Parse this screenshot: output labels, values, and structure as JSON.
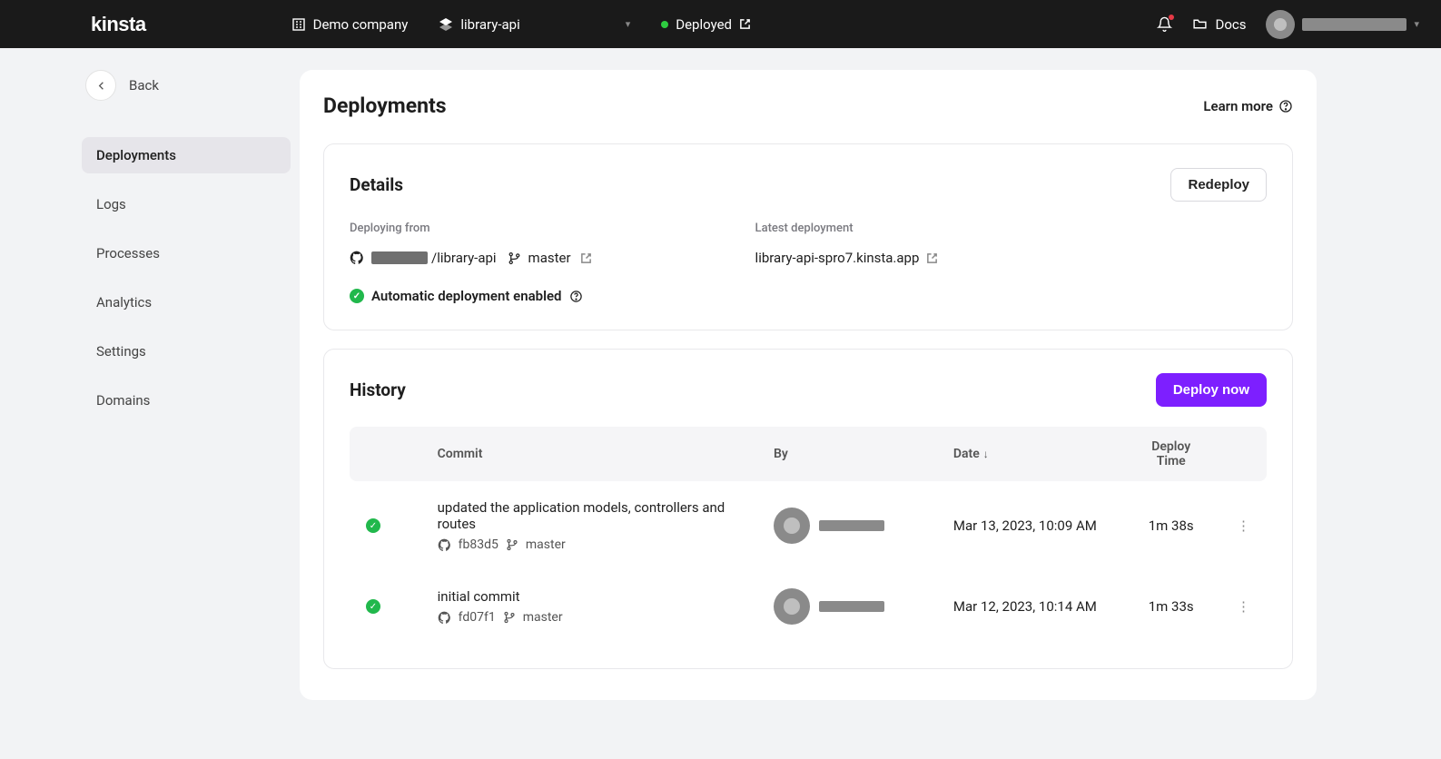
{
  "header": {
    "logo": "kinsta",
    "company": "Demo company",
    "app": "library-api",
    "status": "Deployed",
    "docs": "Docs"
  },
  "sidebar": {
    "back": "Back",
    "items": [
      "Deployments",
      "Logs",
      "Processes",
      "Analytics",
      "Settings",
      "Domains"
    ],
    "active_index": 0
  },
  "page": {
    "title": "Deployments",
    "learn_more": "Learn more"
  },
  "details": {
    "title": "Details",
    "redeploy": "Redeploy",
    "deploying_from_label": "Deploying from",
    "repo_suffix": "/library-api",
    "branch": "master",
    "latest_label": "Latest deployment",
    "latest_url": "library-api-spro7.kinsta.app",
    "auto": "Automatic deployment enabled"
  },
  "history": {
    "title": "History",
    "deploy_now": "Deploy now",
    "columns": {
      "commit": "Commit",
      "by": "By",
      "date": "Date",
      "time": "Deploy Time"
    },
    "rows": [
      {
        "msg": "updated the application models, controllers and routes",
        "hash": "fb83d5",
        "branch": "master",
        "date": "Mar 13, 2023, 10:09 AM",
        "time": "1m 38s"
      },
      {
        "msg": "initial commit",
        "hash": "fd07f1",
        "branch": "master",
        "date": "Mar 12, 2023, 10:14 AM",
        "time": "1m 33s"
      }
    ]
  }
}
